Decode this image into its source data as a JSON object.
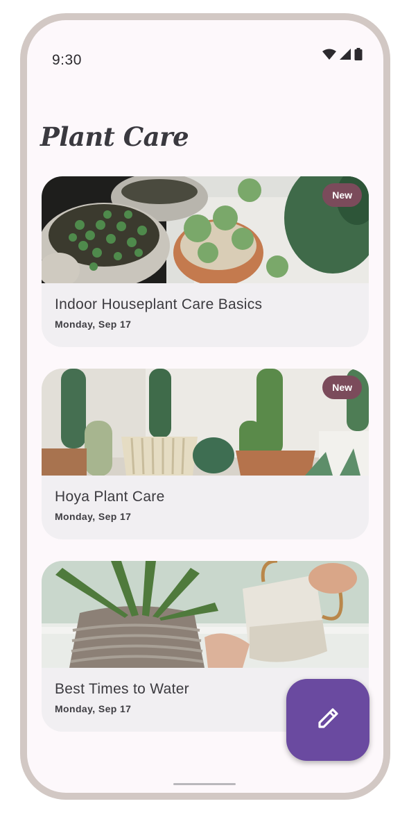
{
  "status_bar": {
    "time": "9:30",
    "icons": [
      "wifi-icon",
      "cellular-signal-icon",
      "battery-icon"
    ]
  },
  "header": {
    "title": "Plant Care"
  },
  "cards": [
    {
      "image": "succulent-pots-image",
      "badge": "New",
      "title": "Indoor Houseplant Care Basics",
      "date": "Monday, Sep 17"
    },
    {
      "image": "cactus-pots-image",
      "badge": "New",
      "title": "Hoya Plant Care",
      "date": "Monday, Sep 17"
    },
    {
      "image": "watering-plant-image",
      "badge": "",
      "title": "Best Times to Water",
      "date": "Monday, Sep 17"
    }
  ],
  "fab": {
    "icon": "edit-pencil-icon"
  },
  "colors": {
    "frame": "#d2c8c4",
    "screen_bg": "#fdf8fb",
    "card_bg": "#f1eff2",
    "badge_bg": "#7b4b5b",
    "fab_bg": "#6a4aa0"
  }
}
